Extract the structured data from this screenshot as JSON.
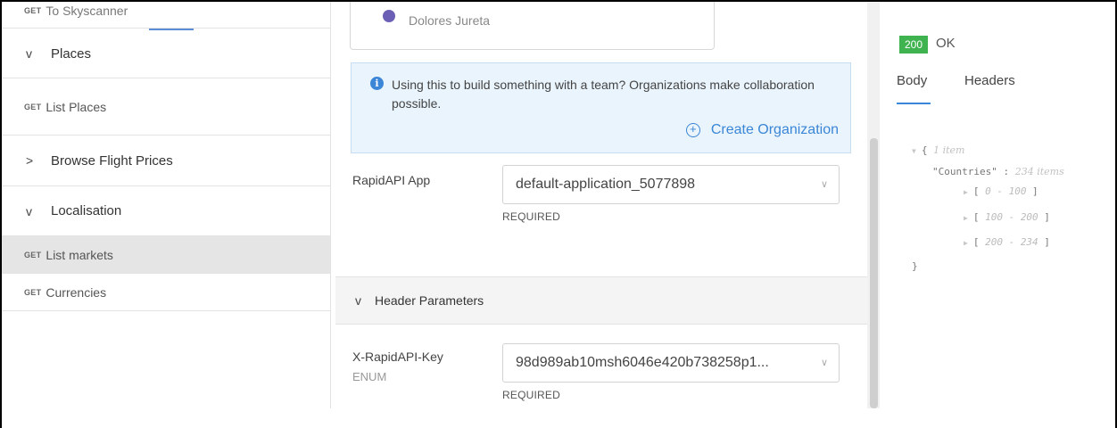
{
  "sidebar": {
    "items": [
      {
        "type": "endpoint",
        "method": "GET",
        "label": "To Skyscanner",
        "active": false
      },
      {
        "type": "group",
        "chevron": "v",
        "label": "Places"
      },
      {
        "type": "endpoint",
        "method": "GET",
        "label": "List Places",
        "active": false
      },
      {
        "type": "group",
        "chevron": ">",
        "label": "Browse Flight Prices"
      },
      {
        "type": "group",
        "chevron": "v",
        "label": "Localisation"
      },
      {
        "type": "endpoint",
        "method": "GET",
        "label": "List markets",
        "active": true
      },
      {
        "type": "endpoint",
        "method": "GET",
        "label": "Currencies",
        "active": false
      }
    ]
  },
  "center": {
    "user_name": "Dolores Jureta",
    "info": {
      "icon": "info-icon",
      "text": "Using this to build something with a team? Organizations make collaboration possible.",
      "create_org": "Create Organization"
    },
    "app_field": {
      "label": "RapidAPI App",
      "value": "default-application_5077898",
      "required": "REQUIRED"
    },
    "header_params": {
      "title": "Header Parameters",
      "chevron": "v"
    },
    "key_field": {
      "label": "X-RapidAPI-Key",
      "sublabel": "ENUM",
      "value": "98d989ab10msh6046e420b738258p1...",
      "required": "REQUIRED"
    }
  },
  "response": {
    "status_code": "200",
    "status_text": "OK",
    "tabs": [
      "Body",
      "Headers"
    ],
    "active_tab": "Body",
    "json": {
      "open": "{",
      "root_meta": "1 item",
      "key": "\"Countries\"",
      "colon": ":",
      "key_meta": "234 items",
      "ranges": [
        "0 - 100",
        "100 - 200",
        "200 - 234"
      ],
      "close": "}"
    }
  },
  "colors": {
    "accent": "#3b86d6",
    "status_ok": "#3fb34f",
    "info_bg": "#e9f4fc",
    "active_row": "#e5e5e5"
  }
}
